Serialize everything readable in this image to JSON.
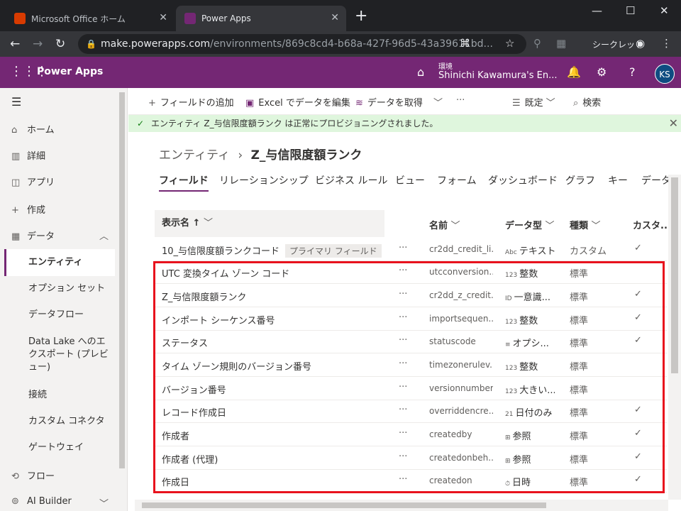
{
  "browser": {
    "tabs": [
      {
        "title": "Microsoft Office ホーム",
        "active": false,
        "favicon_color": "#d83b01"
      },
      {
        "title": "Power Apps",
        "active": true,
        "favicon_color": "#742774"
      }
    ],
    "url_host": "make.powerapps.com",
    "url_path": "/environments/869c8cd4-b68a-427f-96d5-43a39611bd...",
    "incognito_label": "シークレット"
  },
  "header": {
    "app_name": "Power Apps",
    "env_label": "環境",
    "env_name": "Shinichi Kawamura's En...",
    "avatar": "KS",
    "accent": "#742774"
  },
  "sidebar": {
    "items": [
      {
        "label": "ホーム",
        "icon": "home-icon"
      },
      {
        "label": "詳細",
        "icon": "book-icon"
      },
      {
        "label": "アプリ",
        "icon": "apps-icon"
      },
      {
        "label": "作成",
        "icon": "plus-icon"
      },
      {
        "label": "データ",
        "icon": "table-icon"
      }
    ],
    "sub_items": [
      "エンティティ",
      "オプション セット",
      "データフロー",
      "Data Lake へのエクスポート (プレビュー)",
      "接続",
      "カスタム コネクタ",
      "ゲートウェイ"
    ],
    "bottom_items": [
      {
        "label": "フロー",
        "icon": "flow-icon"
      },
      {
        "label": "AI Builder",
        "icon": "ai-builder-icon"
      }
    ]
  },
  "commandbar": {
    "add_field": "フィールドの追加",
    "excel": "Excel でデータを編集",
    "get_data": "データを取得",
    "view": "既定",
    "search": "検索"
  },
  "banner": {
    "text": "エンティティ Z_与信限度額ランク は正常にプロビジョニングされました。"
  },
  "breadcrumb": {
    "parent": "エンティティ",
    "current": "Z_与信限度額ランク"
  },
  "entity_tabs": [
    "フィールド",
    "リレーションシップ",
    "ビジネス ルール",
    "ビュー",
    "フォーム",
    "ダッシュボード",
    "グラフ",
    "キー",
    "データ"
  ],
  "table": {
    "headers": {
      "display_name": "表示名 ↑",
      "name": "名前",
      "data_type": "データ型",
      "type": "種類",
      "custom": "カスタ..."
    },
    "rows": [
      {
        "display": "10_与信限度額ランクコード",
        "badge": "プライマリ フィールド",
        "name": "cr2dd_credit_li...",
        "type_icon": "Abc",
        "dtype": "テキスト",
        "kind": "カスタム",
        "check": "✓"
      },
      {
        "display": "UTC 変換タイム ゾーン コード",
        "badge": "",
        "name": "utcconversion...",
        "type_icon": "123",
        "dtype": "整数",
        "kind": "標準",
        "check": ""
      },
      {
        "display": "Z_与信限度額ランク",
        "badge": "",
        "name": "cr2dd_z_credit...",
        "type_icon": "ID",
        "dtype": "一意識...",
        "kind": "標準",
        "check": "✓"
      },
      {
        "display": "インポート シーケンス番号",
        "badge": "",
        "name": "importsequen...",
        "type_icon": "123",
        "dtype": "整数",
        "kind": "標準",
        "check": "✓"
      },
      {
        "display": "ステータス",
        "badge": "",
        "name": "statuscode",
        "type_icon": "≡",
        "dtype": "オプシ...",
        "kind": "標準",
        "check": "✓"
      },
      {
        "display": "タイム ゾーン規則のバージョン番号",
        "badge": "",
        "name": "timezonerulev...",
        "type_icon": "123",
        "dtype": "整数",
        "kind": "標準",
        "check": ""
      },
      {
        "display": "バージョン番号",
        "badge": "",
        "name": "versionnumber",
        "type_icon": "123",
        "dtype": "大きい...",
        "kind": "標準",
        "check": ""
      },
      {
        "display": "レコード作成日",
        "badge": "",
        "name": "overriddencre...",
        "type_icon": "21",
        "dtype": "日付のみ",
        "kind": "標準",
        "check": "✓"
      },
      {
        "display": "作成者",
        "badge": "",
        "name": "createdby",
        "type_icon": "⊞",
        "dtype": "参照",
        "kind": "標準",
        "check": "✓"
      },
      {
        "display": "作成者 (代理)",
        "badge": "",
        "name": "createdonbeh...",
        "type_icon": "⊞",
        "dtype": "参照",
        "kind": "標準",
        "check": "✓"
      },
      {
        "display": "作成日",
        "badge": "",
        "name": "createdon",
        "type_icon": "⏱",
        "dtype": "日時",
        "kind": "標準",
        "check": "✓"
      }
    ]
  }
}
